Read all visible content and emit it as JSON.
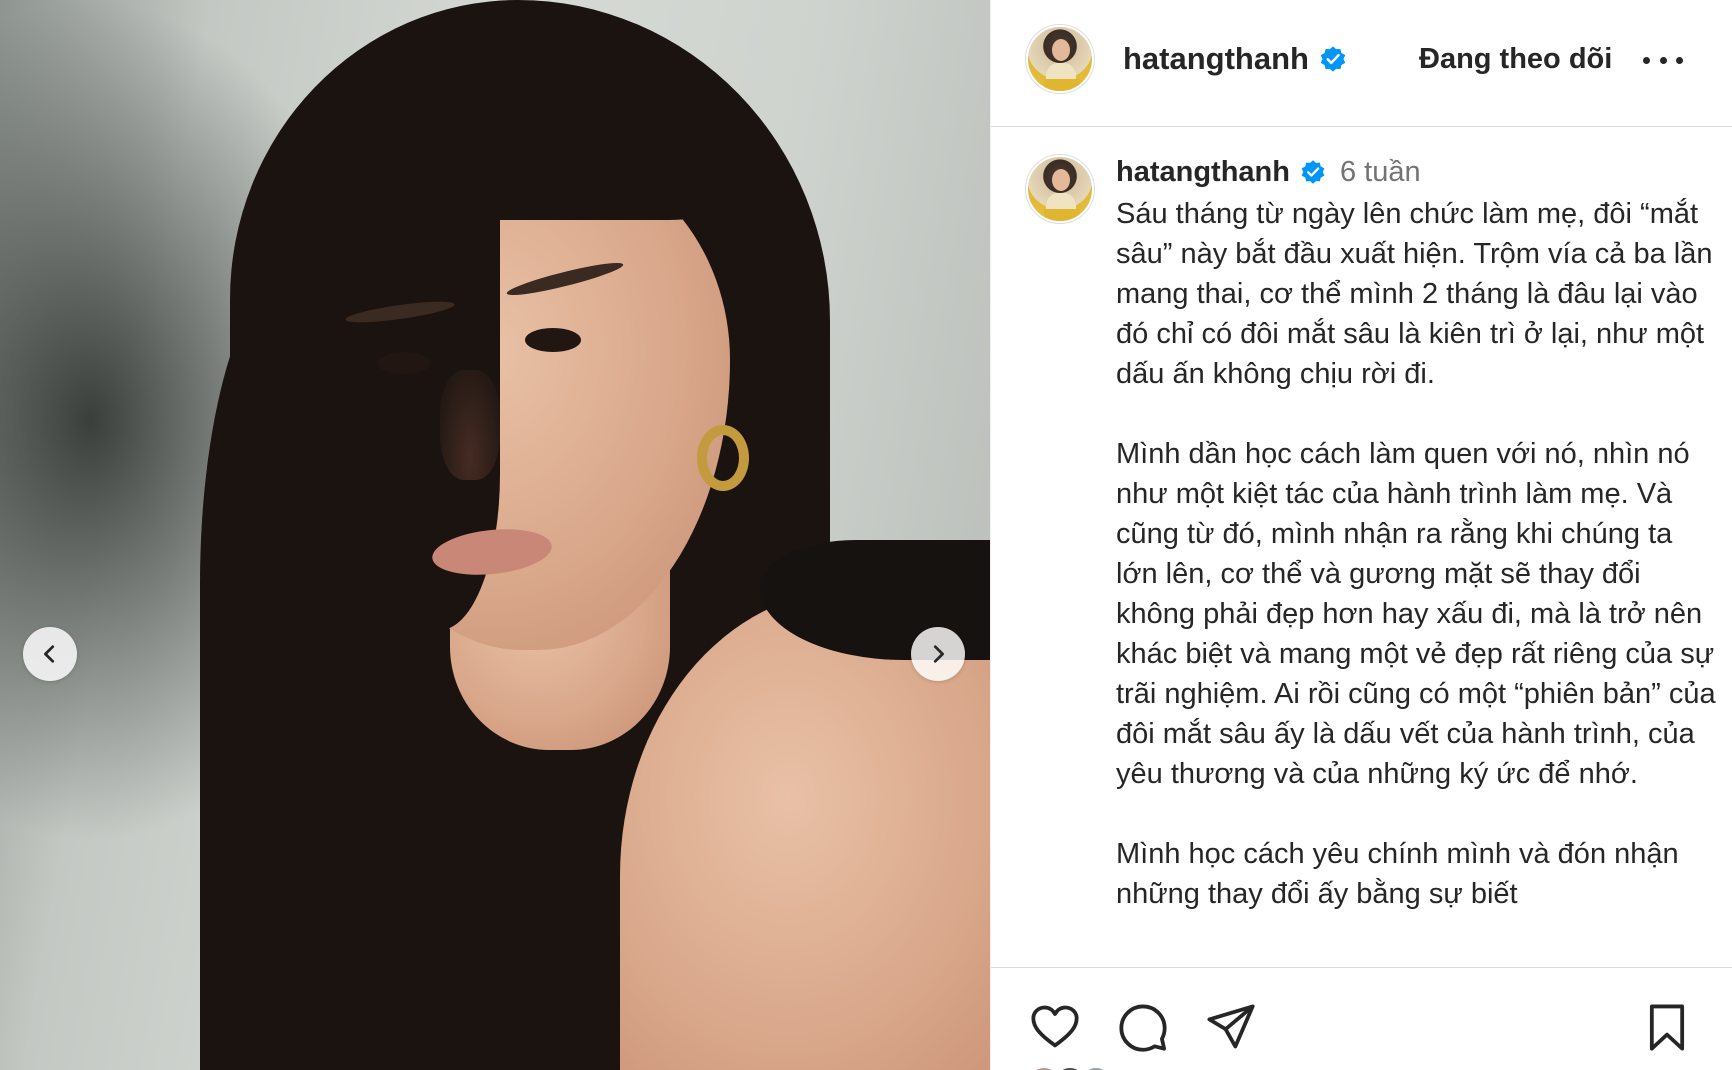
{
  "post": {
    "username": "hatangthanh",
    "follow_state": "Đang theo dõi",
    "timestamp": "6 tuần",
    "caption": "Sáu tháng từ ngày lên chức làm mẹ, đôi “mắt sâu” này bắt đầu xuất hiện. Trộm vía cả ba lần mang thai, cơ thể mình 2 tháng là đâu lại vào đó chỉ có đôi mắt sâu là kiên trì ở lại, như một dấu ấn không chịu rời đi.\n\nMình dần học cách làm quen với nó, nhìn nó như một kiệt tác của hành trình làm mẹ. Và cũng từ đó, mình nhận ra rằng khi chúng ta lớn lên, cơ thể và gương mặt sẽ thay đổi không phải đẹp hơn hay xấu đi, mà là trở nên khác biệt và mang một vẻ đẹp rất riêng của sự trãi nghiệm. Ai rồi cũng có một “phiên bản” của đôi mắt sâu ấy là dấu vết của hành trình, của yêu thương và của những ký ức để nhớ.\n\nMình học cách yêu chính mình và đón nhận những thay đổi ấy bằng sự biết"
  },
  "icons": {
    "verified": "verified-badge-icon",
    "more": "more-options-icon",
    "prev": "chevron-left-icon",
    "next": "chevron-right-icon",
    "like": "heart-icon",
    "comment": "comment-icon",
    "share": "share-icon",
    "save": "bookmark-icon"
  },
  "colors": {
    "verified_blue": "#0095f6",
    "text": "#262626",
    "muted": "#737373",
    "divider": "#dbdbdb"
  }
}
